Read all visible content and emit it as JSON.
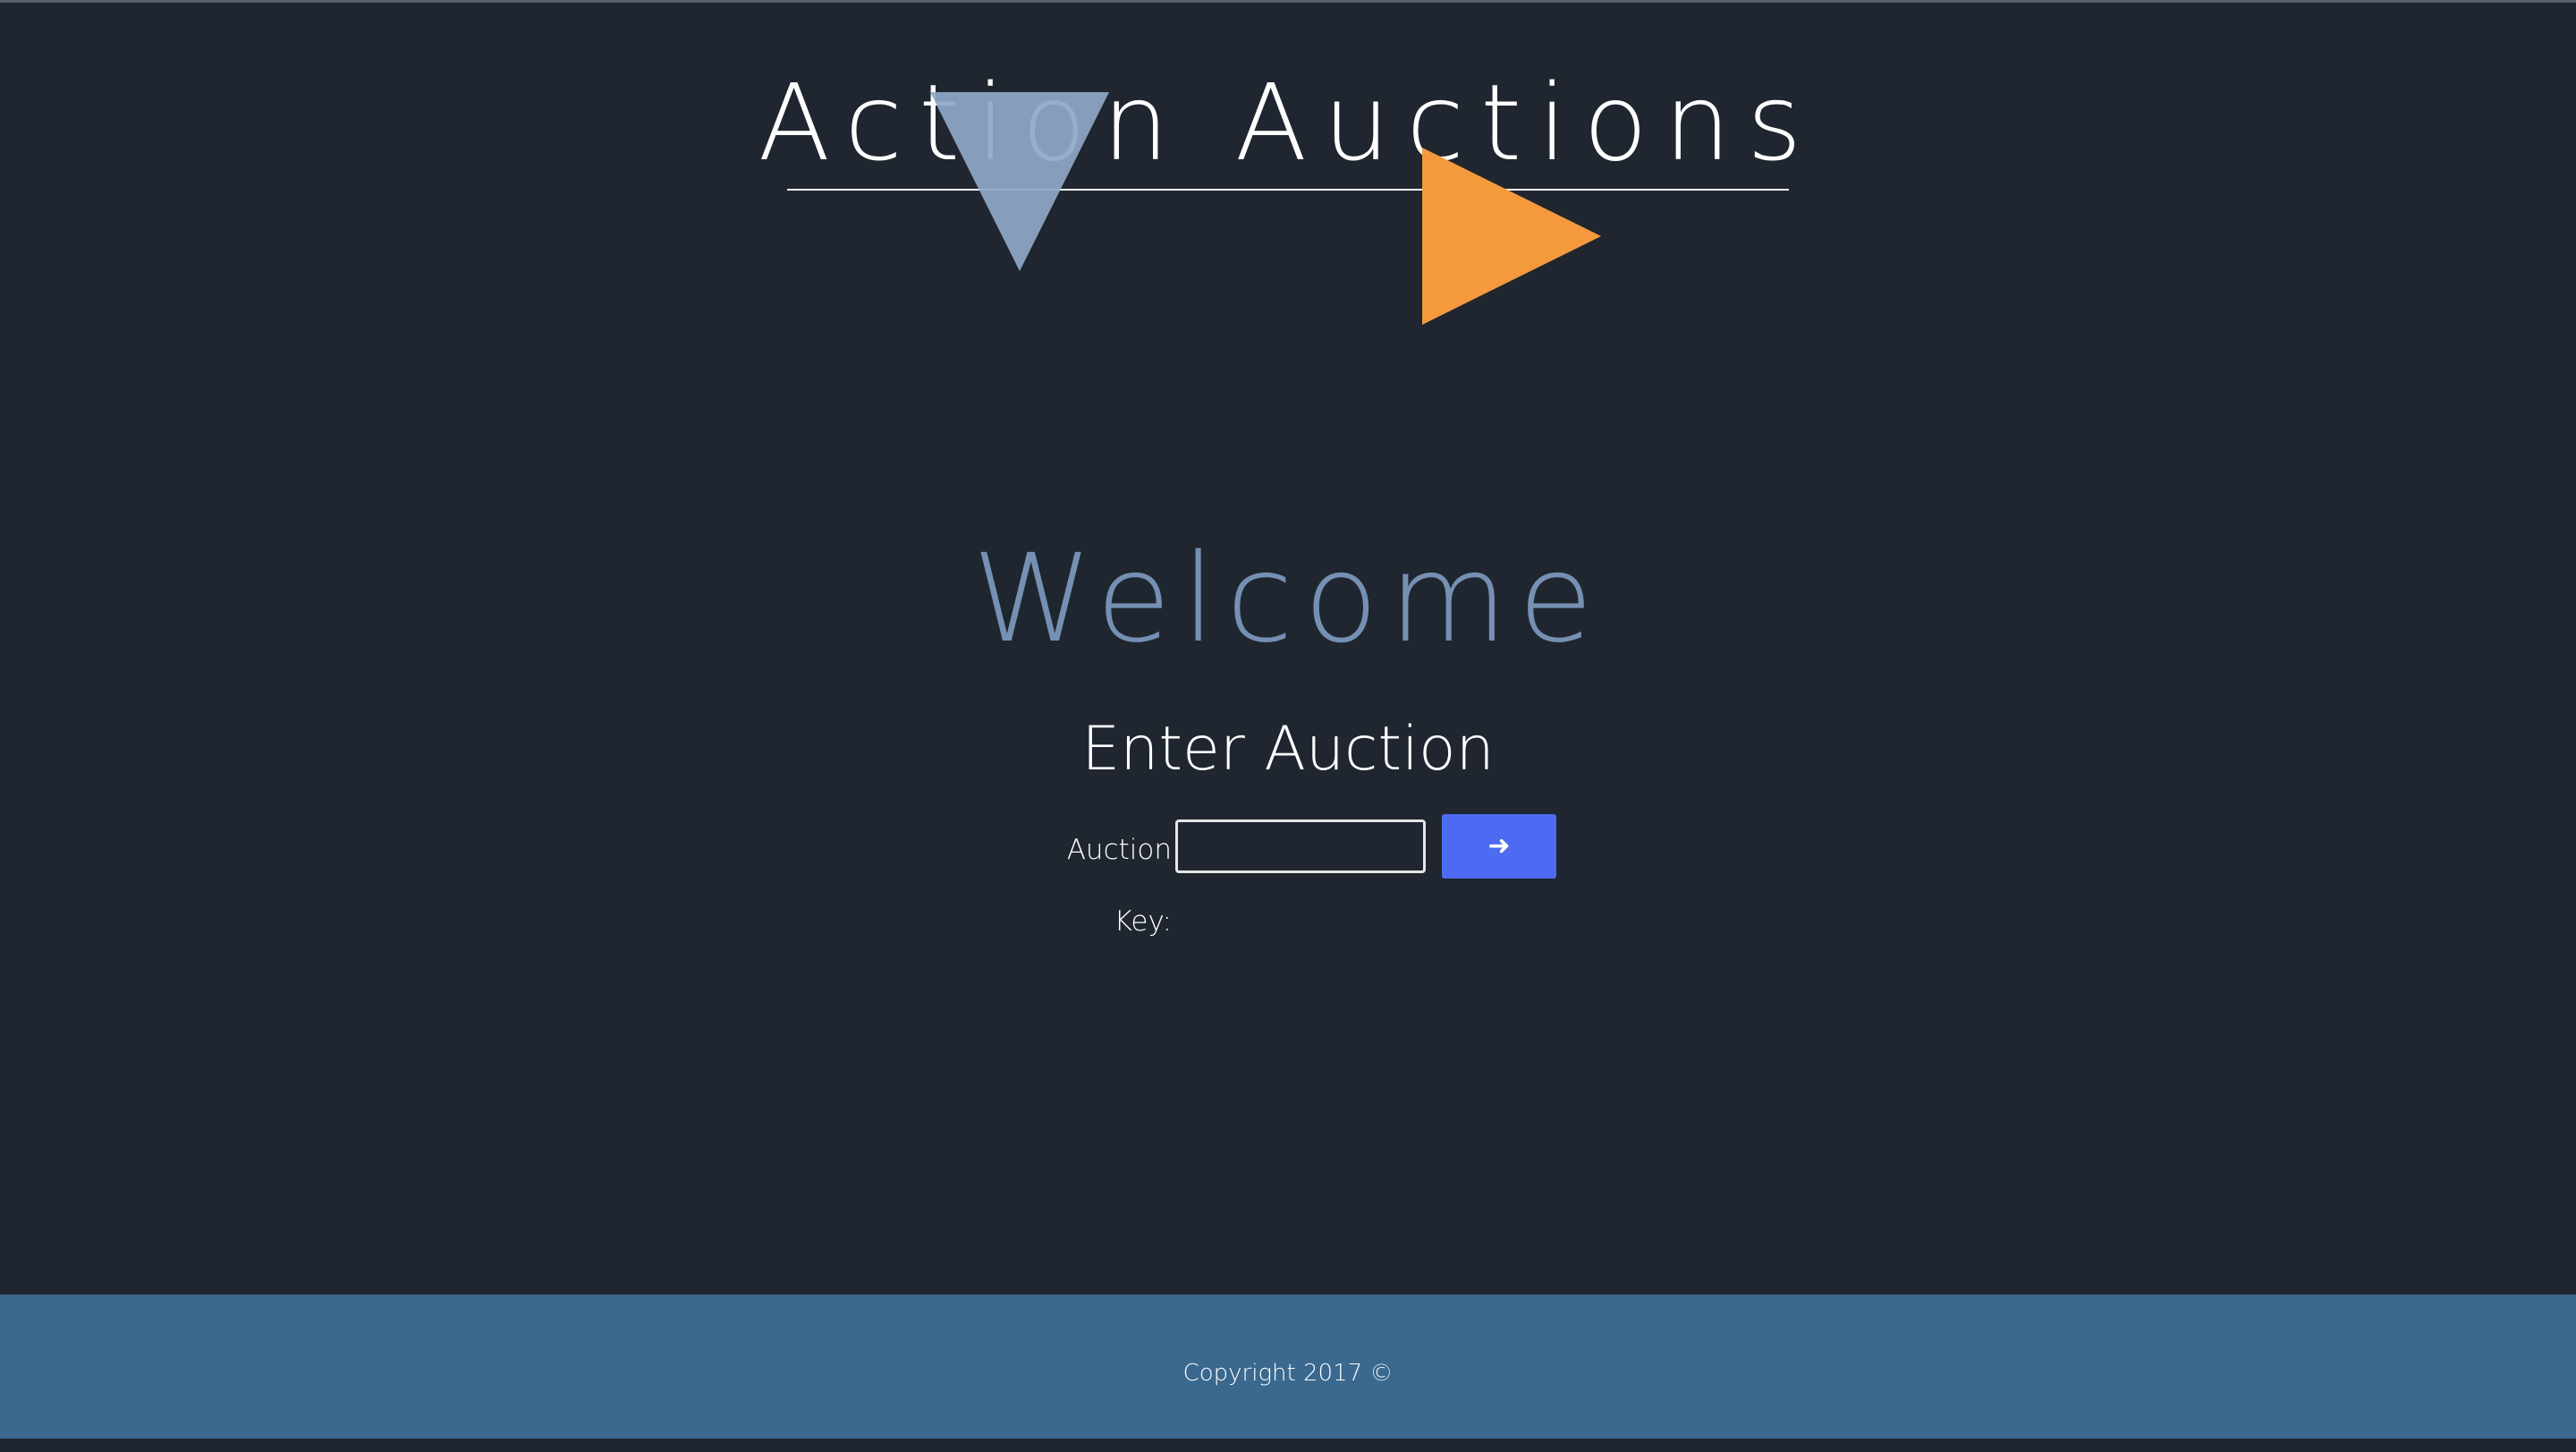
{
  "header": {
    "title": "Action Auctions"
  },
  "main": {
    "welcome": "Welcome",
    "enter_title": "Enter Auction",
    "key_label": "Auction Key:",
    "key_value": "",
    "submit_icon": "arrow-right-icon",
    "submit_glyph": "➜"
  },
  "footer": {
    "copyright": "Copyright 2017 ©"
  },
  "colors": {
    "background": "#1f2630",
    "footer": "#3a688f",
    "accent_blue": "#4d6bf2",
    "welcome_text": "#7590b2",
    "triangle_down": "#8fa8c8",
    "triangle_right": "#f5993d"
  }
}
